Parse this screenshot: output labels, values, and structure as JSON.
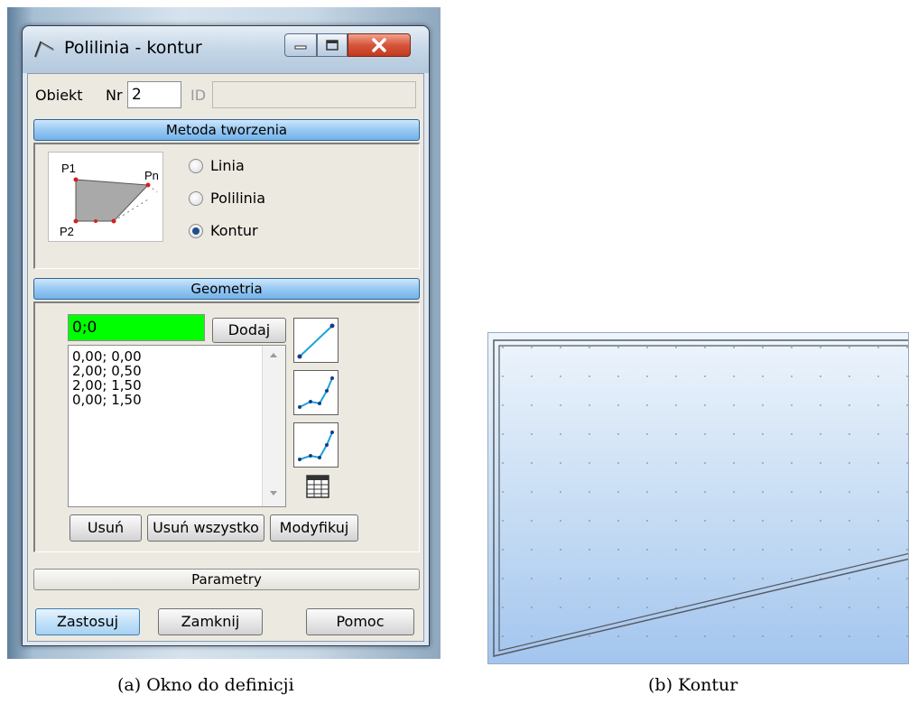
{
  "window": {
    "title": "Polilinia - kontur"
  },
  "object": {
    "label": "Obiekt",
    "nr_label": "Nr",
    "nr_value": "2",
    "id_label": "ID",
    "id_value": ""
  },
  "method": {
    "header": "Metoda tworzenia",
    "diagram_labels": {
      "p1": "P1",
      "pn": "Pn",
      "p2": "P2"
    },
    "options": [
      {
        "label": "Linia",
        "selected": false
      },
      {
        "label": "Polilinia",
        "selected": false
      },
      {
        "label": "Kontur",
        "selected": true
      }
    ]
  },
  "geometry": {
    "header": "Geometria",
    "input_value": "0;0",
    "input_color": "#00ff00",
    "add_label": "Dodaj",
    "points": [
      "0,00; 0,00",
      "2,00; 0,50",
      "2,00; 1,50",
      "0,00; 1,50"
    ],
    "delete_label": "Usuń",
    "delete_all_label": "Usuń wszystko",
    "modify_label": "Modyfikuj",
    "tool_icons": [
      "line-tool-icon",
      "polyline-tool-icon",
      "polyline-tool-icon-2",
      "table-icon"
    ]
  },
  "parameters": {
    "header": "Parametry"
  },
  "footer": {
    "apply_label": "Zastosuj",
    "close_label": "Zamknij",
    "help_label": "Pomoc"
  },
  "captions": {
    "left": "(a) Okno do definicji",
    "right": "(b) Kontur"
  },
  "colors": {
    "section_blue": "#9ccbf3",
    "contour_fill": "#a3c5ee",
    "point_red": "#d62020"
  }
}
